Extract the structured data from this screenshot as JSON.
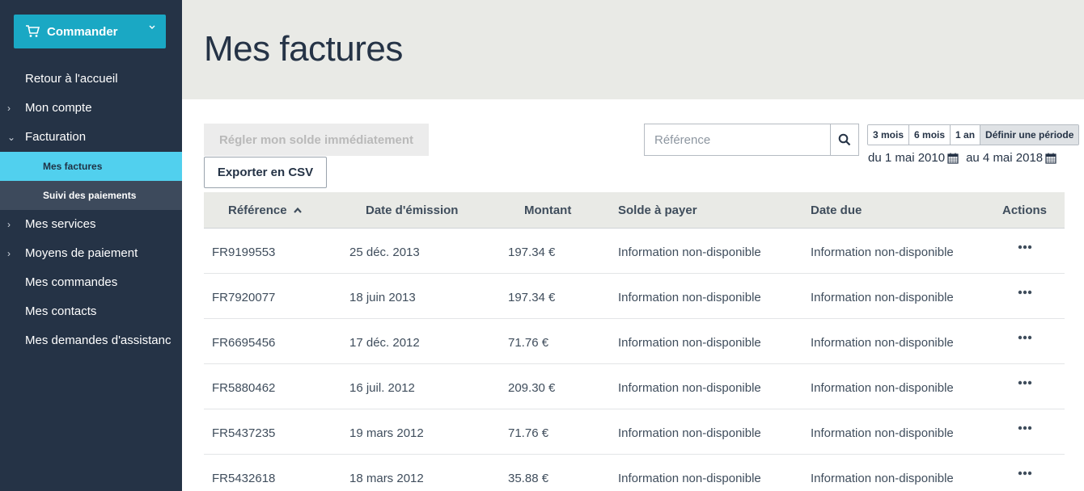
{
  "sidebar": {
    "order_button": "Commander",
    "nav": [
      {
        "label": "Retour à l'accueil",
        "arrow": ""
      },
      {
        "label": "Mon compte",
        "arrow": "›"
      },
      {
        "label": "Facturation",
        "arrow": "⌄"
      }
    ],
    "billing_sub": [
      {
        "label": "Mes factures"
      },
      {
        "label": "Suivi des paiements"
      }
    ],
    "nav_after": [
      {
        "label": "Mes services",
        "arrow": "›"
      },
      {
        "label": "Moyens de paiement",
        "arrow": "›"
      },
      {
        "label": "Mes commandes",
        "arrow": ""
      },
      {
        "label": "Mes contacts",
        "arrow": ""
      },
      {
        "label": "Mes demandes d'assistanc",
        "arrow": ""
      }
    ]
  },
  "header": {
    "title": "Mes factures"
  },
  "toolbar": {
    "settle_label": "Régler mon solde immédiatement",
    "export_label": "Exporter en CSV",
    "search_placeholder": "Référence",
    "periods": [
      "3 mois",
      "6 mois",
      "1 an",
      "Définir une période"
    ],
    "selected_period": "Définir une période",
    "date_from": "du 1 mai 2010",
    "date_to": "au 4 mai 2018"
  },
  "table": {
    "headers": {
      "reference": "Référence",
      "date": "Date d'émission",
      "amount": "Montant",
      "balance": "Solde à payer",
      "due": "Date due",
      "actions": "Actions"
    },
    "rows": [
      {
        "reference": "FR9199553",
        "date": "25 déc. 2013",
        "amount": "197.34 €",
        "balance": "Information non-disponible",
        "due": "Information non-disponible"
      },
      {
        "reference": "FR7920077",
        "date": "18 juin 2013",
        "amount": "197.34 €",
        "balance": "Information non-disponible",
        "due": "Information non-disponible"
      },
      {
        "reference": "FR6695456",
        "date": "17 déc. 2012",
        "amount": "71.76 €",
        "balance": "Information non-disponible",
        "due": "Information non-disponible"
      },
      {
        "reference": "FR5880462",
        "date": "16 juil. 2012",
        "amount": "209.30 €",
        "balance": "Information non-disponible",
        "due": "Information non-disponible"
      },
      {
        "reference": "FR5437235",
        "date": "19 mars 2012",
        "amount": "71.76 €",
        "balance": "Information non-disponible",
        "due": "Information non-disponible"
      },
      {
        "reference": "FR5432618",
        "date": "18 mars 2012",
        "amount": "35.88 €",
        "balance": "Information non-disponible",
        "due": "Information non-disponible"
      }
    ]
  },
  "colors": {
    "sidebar_bg": "#253346",
    "accent": "#1aa8c4",
    "active_item": "#51d0ee",
    "header_bg": "#e9eae6"
  }
}
